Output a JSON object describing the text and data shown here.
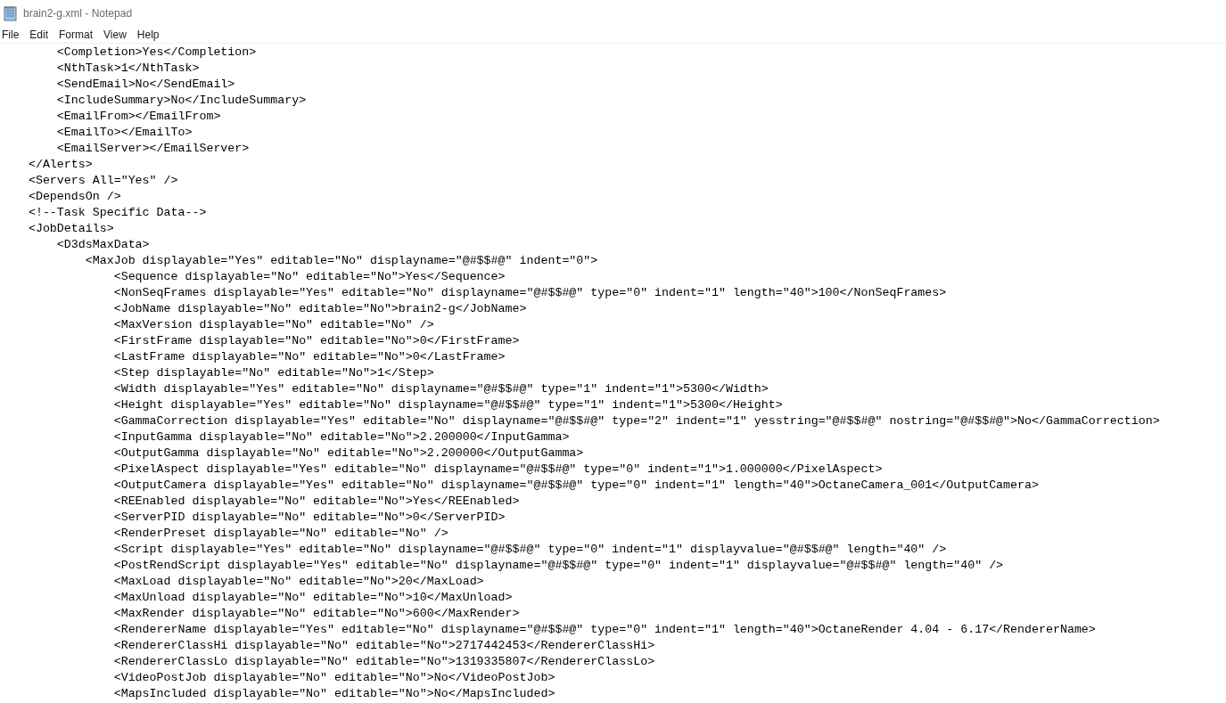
{
  "window": {
    "title": "brain2-g.xml - Notepad"
  },
  "menu": [
    "File",
    "Edit",
    "Format",
    "View",
    "Help"
  ],
  "lines": [
    "        <Completion>Yes</Completion>",
    "        <NthTask>1</NthTask>",
    "        <SendEmail>No</SendEmail>",
    "        <IncludeSummary>No</IncludeSummary>",
    "        <EmailFrom></EmailFrom>",
    "        <EmailTo></EmailTo>",
    "        <EmailServer></EmailServer>",
    "    </Alerts>",
    "    <Servers All=\"Yes\" />",
    "    <DependsOn />",
    "    <!--Task Specific Data-->",
    "    <JobDetails>",
    "        <D3dsMaxData>",
    "            <MaxJob displayable=\"Yes\" editable=\"No\" displayname=\"@#$$#@\" indent=\"0\">",
    "                <Sequence displayable=\"No\" editable=\"No\">Yes</Sequence>",
    "                <NonSeqFrames displayable=\"Yes\" editable=\"No\" displayname=\"@#$$#@\" type=\"0\" indent=\"1\" length=\"40\">100</NonSeqFrames>",
    "                <JobName displayable=\"No\" editable=\"No\">brain2-g</JobName>",
    "                <MaxVersion displayable=\"No\" editable=\"No\" />",
    "                <FirstFrame displayable=\"No\" editable=\"No\">0</FirstFrame>",
    "                <LastFrame displayable=\"No\" editable=\"No\">0</LastFrame>",
    "                <Step displayable=\"No\" editable=\"No\">1</Step>",
    "                <Width displayable=\"Yes\" editable=\"No\" displayname=\"@#$$#@\" type=\"1\" indent=\"1\">5300</Width>",
    "                <Height displayable=\"Yes\" editable=\"No\" displayname=\"@#$$#@\" type=\"1\" indent=\"1\">5300</Height>",
    "                <GammaCorrection displayable=\"Yes\" editable=\"No\" displayname=\"@#$$#@\" type=\"2\" indent=\"1\" yesstring=\"@#$$#@\" nostring=\"@#$$#@\">No</GammaCorrection>",
    "                <InputGamma displayable=\"No\" editable=\"No\">2.200000</InputGamma>",
    "                <OutputGamma displayable=\"No\" editable=\"No\">2.200000</OutputGamma>",
    "                <PixelAspect displayable=\"Yes\" editable=\"No\" displayname=\"@#$$#@\" type=\"0\" indent=\"1\">1.000000</PixelAspect>",
    "                <OutputCamera displayable=\"Yes\" editable=\"No\" displayname=\"@#$$#@\" type=\"0\" indent=\"1\" length=\"40\">OctaneCamera_001</OutputCamera>",
    "                <REEnabled displayable=\"No\" editable=\"No\">Yes</REEnabled>",
    "                <ServerPID displayable=\"No\" editable=\"No\">0</ServerPID>",
    "                <RenderPreset displayable=\"No\" editable=\"No\" />",
    "                <Script displayable=\"Yes\" editable=\"No\" displayname=\"@#$$#@\" type=\"0\" indent=\"1\" displayvalue=\"@#$$#@\" length=\"40\" />",
    "                <PostRendScript displayable=\"Yes\" editable=\"No\" displayname=\"@#$$#@\" type=\"0\" indent=\"1\" displayvalue=\"@#$$#@\" length=\"40\" />",
    "                <MaxLoad displayable=\"No\" editable=\"No\">20</MaxLoad>",
    "                <MaxUnload displayable=\"No\" editable=\"No\">10</MaxUnload>",
    "                <MaxRender displayable=\"No\" editable=\"No\">600</MaxRender>",
    "                <RendererName displayable=\"Yes\" editable=\"No\" displayname=\"@#$$#@\" type=\"0\" indent=\"1\" length=\"40\">OctaneRender 4.04 - 6.17</RendererName>",
    "                <RendererClassHi displayable=\"No\" editable=\"No\">2717442453</RendererClassHi>",
    "                <RendererClassLo displayable=\"No\" editable=\"No\">1319335807</RendererClassLo>",
    "                <VideoPostJob displayable=\"No\" editable=\"No\">No</VideoPostJob>",
    "                <MapsIncluded displayable=\"No\" editable=\"No\">No</MapsIncluded>"
  ]
}
